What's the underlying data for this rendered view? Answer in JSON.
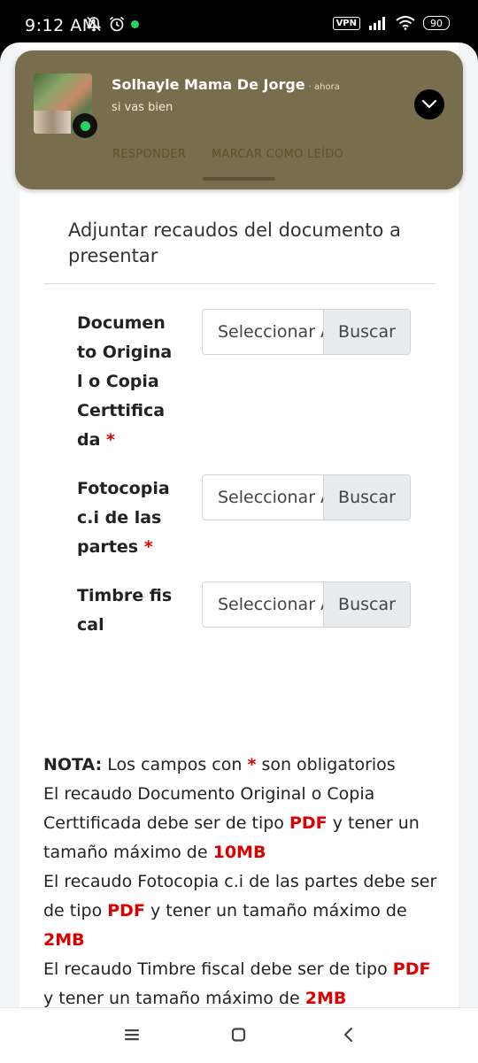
{
  "status_bar": {
    "time": "9:12 AM",
    "vpn": "VPN",
    "battery": "90"
  },
  "notification": {
    "sender": "Solhayle Mama De Jorge",
    "time": "· ahora",
    "message": "si vas bien",
    "reply_label": "RESPONDER",
    "mark_read_label": "MARCAR COMO LEÍDO"
  },
  "form": {
    "title": "Adjuntar recaudos del documento a presentar",
    "required_mark": "*",
    "fields": [
      {
        "label": "Documento Original o Copia Certtificada",
        "required": true,
        "placeholder": "Seleccionar Archivo",
        "button": "Buscar"
      },
      {
        "label": "Fotocopia c.i de las partes",
        "required": true,
        "placeholder": "Seleccionar Archivo",
        "button": "Buscar"
      },
      {
        "label": "Timbre fiscal",
        "required": false,
        "placeholder": "Seleccionar Archivo",
        "button": "Buscar"
      }
    ]
  },
  "note": {
    "label": "NOTA:",
    "required_text_before": "Los campos con",
    "required_mark": "*",
    "required_text_after": "son obligatorios",
    "lines": [
      {
        "pre": "El recaudo Documento Original o Copia Certtificada debe ser de tipo",
        "type": "PDF",
        "mid": "y tener un tamaño máximo de",
        "size": "10MB"
      },
      {
        "pre": "El recaudo Fotocopia c.i de las partes debe ser de tipo",
        "type": "PDF",
        "mid": "y tener un tamaño máximo de",
        "size": "2MB"
      },
      {
        "pre": "El recaudo Timbre fiscal debe ser de tipo",
        "type": "PDF",
        "mid": "y tener un tamaño máximo de",
        "size": "2MB"
      }
    ]
  },
  "nav_bar": {
    "icons": [
      "menu-icon",
      "home-icon",
      "back-icon"
    ]
  }
}
